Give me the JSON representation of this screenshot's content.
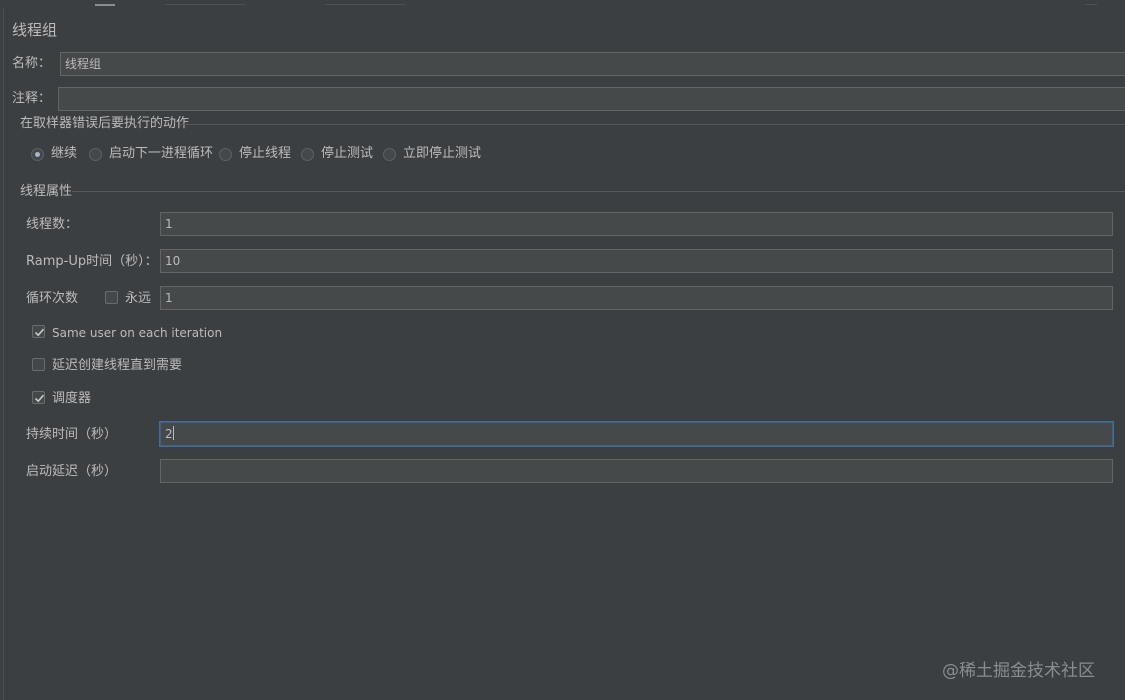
{
  "panel": {
    "title": "线程组",
    "name_label": "名称：",
    "name_value": "线程组",
    "comment_label": "注释：",
    "comment_value": ""
  },
  "error_action": {
    "group_title": "在取样器错误后要执行的动作",
    "options": [
      {
        "label": "继续",
        "selected": true
      },
      {
        "label": "启动下一进程循环",
        "selected": false
      },
      {
        "label": "停止线程",
        "selected": false
      },
      {
        "label": "停止测试",
        "selected": false
      },
      {
        "label": "立即停止测试",
        "selected": false
      }
    ]
  },
  "thread_props": {
    "group_title": "线程属性",
    "threads_label": "线程数：",
    "threads_value": "1",
    "rampup_label": "Ramp-Up时间（秒）：",
    "rampup_value": "10",
    "loop_label": "循环次数",
    "forever_label": "永远",
    "forever_checked": false,
    "loop_value": "1",
    "same_user_label": "Same user on each iteration",
    "same_user_checked": true,
    "delay_create_label": "延迟创建线程直到需要",
    "delay_create_checked": false,
    "scheduler_label": "调度器",
    "scheduler_checked": true,
    "duration_label": "持续时间（秒）",
    "duration_value": "2",
    "startup_delay_label": "启动延迟（秒）",
    "startup_delay_value": ""
  },
  "watermark": "@稀土掘金技术社区",
  "colors": {
    "background": "#3c3f41",
    "field_bg": "#45494a",
    "field_border": "#646464",
    "focus_border": "#466d94",
    "text": "#bbbbbb"
  }
}
